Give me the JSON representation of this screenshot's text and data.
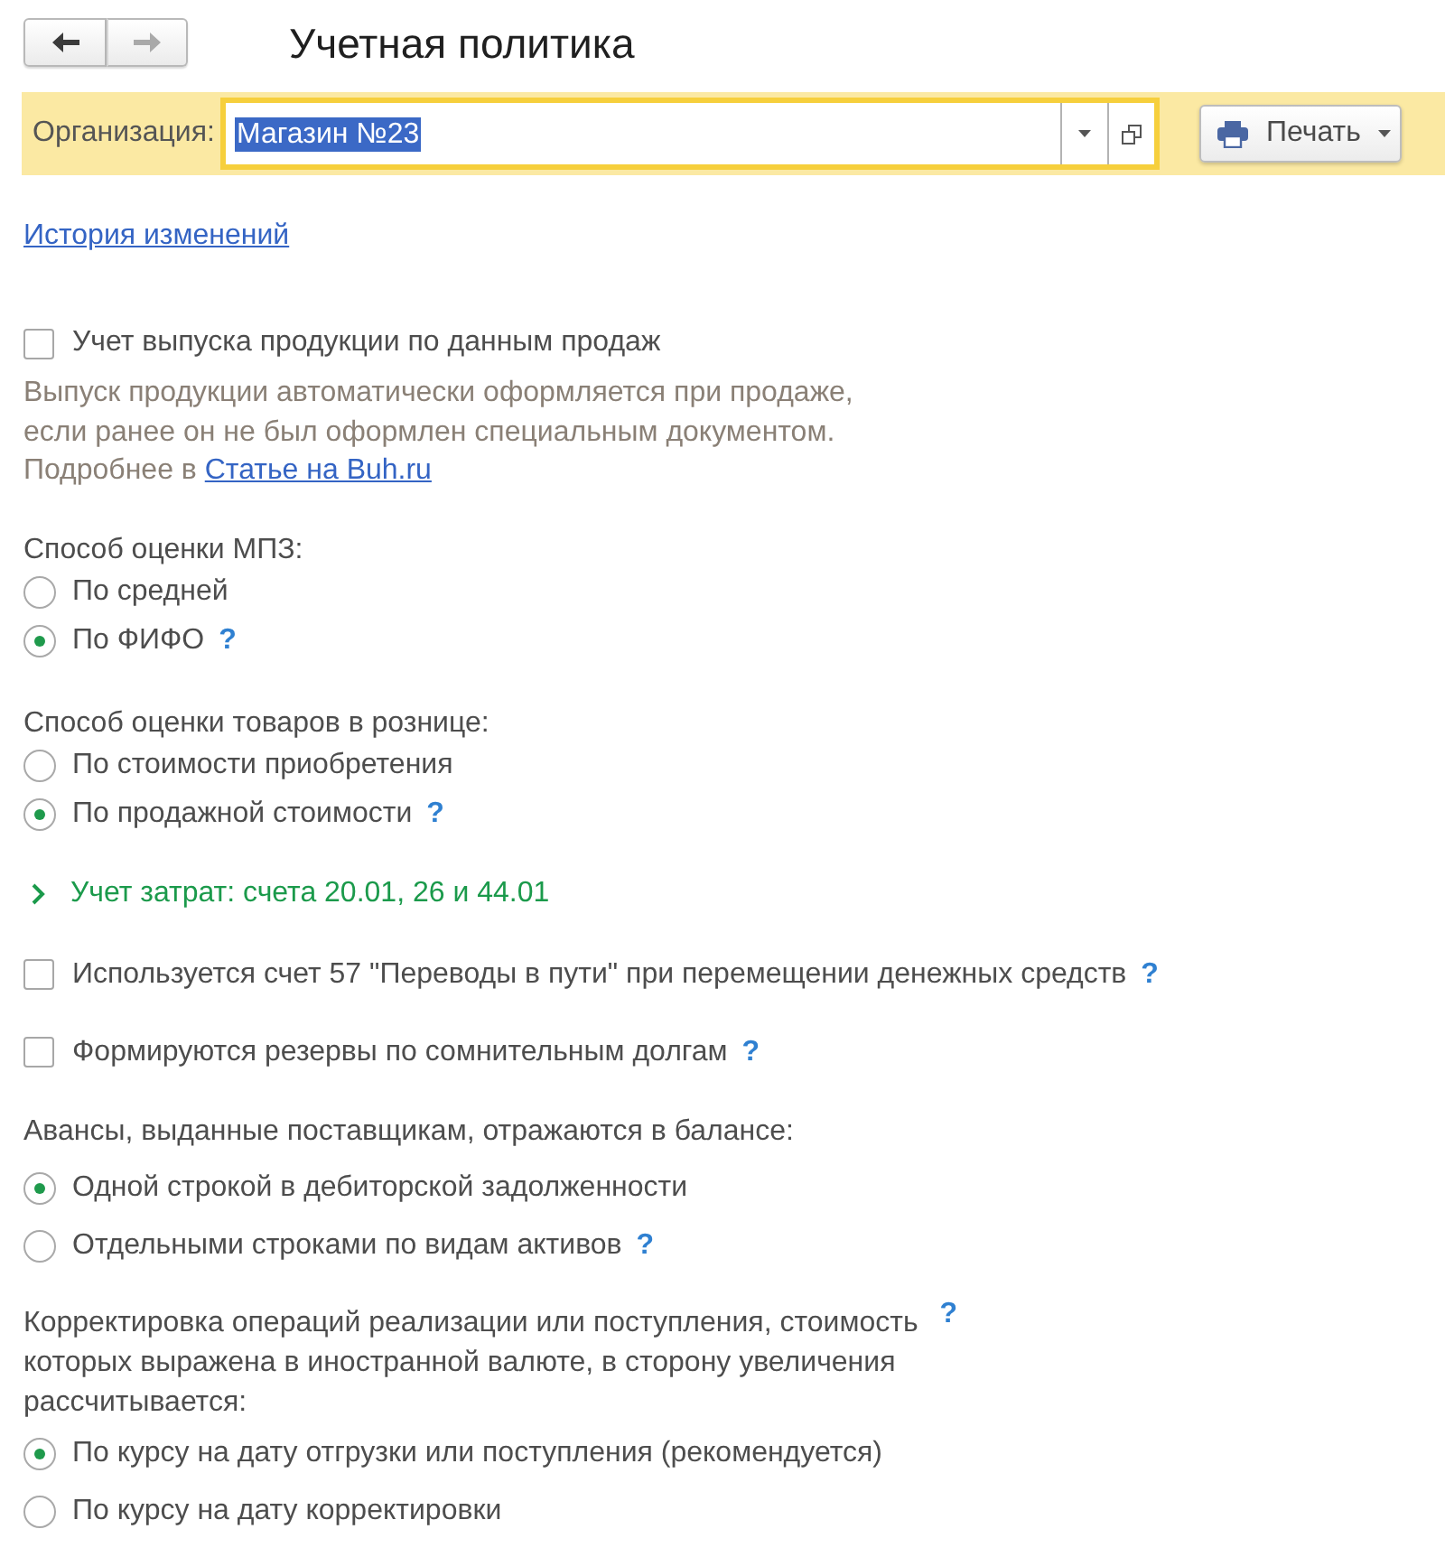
{
  "navigation": {
    "buttons": [
      {
        "kind": "back",
        "disabled": false
      },
      {
        "kind": "forward",
        "disabled": true
      }
    ]
  },
  "title": "Учетная политика",
  "organization": {
    "label": "Организация:",
    "value": "Магазин №23",
    "value_selected": true
  },
  "print_button": {
    "label": "Печать"
  },
  "history_link": "История изменений",
  "items": [
    {
      "kind": "checkbox",
      "label": "Учет выпуска продукции по данным продаж",
      "checked": false
    },
    {
      "kind": "note",
      "lines": [
        "Выпуск продукции автоматически оформляется при продаже,",
        "если ранее он не был оформлен специальным документом.",
        "Подробнее в"
      ],
      "link": "Статье на Buh.ru"
    },
    {
      "kind": "radio_group",
      "title_lines": [
        "Способ оценки МПЗ:"
      ],
      "options": [
        {
          "label": "По средней",
          "selected": false
        },
        {
          "label": "По ФИФО",
          "selected": true,
          "help": "?"
        }
      ]
    },
    {
      "kind": "radio_group",
      "title_lines": [
        "Способ оценки товаров в рознице:"
      ],
      "options": [
        {
          "label": "По стоимости приобретения",
          "selected": false
        },
        {
          "label": "По продажной стоимости",
          "selected": true,
          "help": "?"
        }
      ]
    },
    {
      "kind": "expander",
      "label": "Учет затрат: счета 20.01, 26 и 44.01",
      "expanded": false
    },
    {
      "kind": "checkbox",
      "label": "Используется счет 57 \"Переводы в пути\" при перемещении денежных средств",
      "checked": false,
      "help": "?"
    },
    {
      "kind": "checkbox",
      "label": "Формируются резервы по сомнительным долгам",
      "checked": false,
      "help": "?"
    },
    {
      "kind": "radio_group",
      "title_lines": [
        "Авансы, выданные поставщикам, отражаются в балансе:"
      ],
      "options": [
        {
          "label": "Одной строкой в дебиторской задолженности",
          "selected": true
        },
        {
          "label": "Отдельными строками по видам активов",
          "selected": false,
          "help": "?"
        }
      ]
    },
    {
      "kind": "radio_group",
      "title_lines": [
        "Корректировка операций реализации или поступления, стоимость",
        "которых выражена в иностранной валюте, в сторону увеличения",
        "рассчитывается:"
      ],
      "title_help": "?",
      "options": [
        {
          "label": "По курсу на дату отгрузки или поступления (рекомендуется)",
          "selected": true
        },
        {
          "label": "По курсу на дату корректировки",
          "selected": false
        }
      ]
    }
  ]
}
